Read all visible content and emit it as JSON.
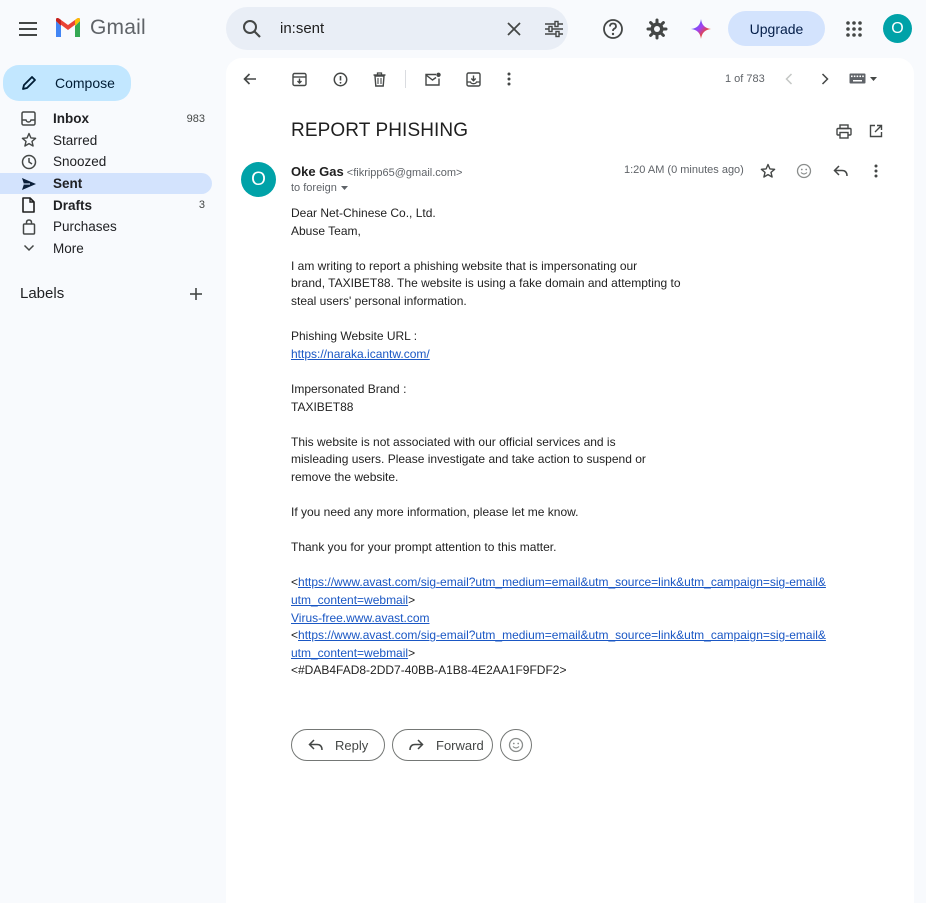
{
  "app": {
    "name": "Gmail"
  },
  "search": {
    "value": "in:sent"
  },
  "topbar": {
    "upgrade_label": "Upgrade",
    "avatar_letter": "O"
  },
  "sidebar": {
    "compose_label": "Compose",
    "items": [
      {
        "label": "Inbox",
        "count": "983"
      },
      {
        "label": "Starred",
        "count": ""
      },
      {
        "label": "Snoozed",
        "count": ""
      },
      {
        "label": "Sent",
        "count": ""
      },
      {
        "label": "Drafts",
        "count": "3"
      },
      {
        "label": "Purchases",
        "count": ""
      },
      {
        "label": "More",
        "count": ""
      }
    ],
    "labels_title": "Labels"
  },
  "toolbar": {
    "pager": "1 of 783"
  },
  "email": {
    "subject": "REPORT PHISHING",
    "sender_letter": "O",
    "sender_name": "Oke Gas",
    "sender_email": "<fikripp65@gmail.com>",
    "to": "to foreign",
    "timestamp": "1:20 AM (0 minutes ago)",
    "body": {
      "l1": "Dear Net-Chinese Co., Ltd.",
      "l2": "Abuse Team,",
      "l3": "I am writing to report a phishing website that is impersonating our",
      "l4": "brand, TAXIBET88. The website is using a fake domain and attempting to",
      "l5": "steal users' personal information.",
      "l6": "Phishing Website URL :",
      "l7": "https://naraka.icantw.com/",
      "l8": "Impersonated Brand :",
      "l9": "TAXIBET88",
      "l10": "This website is not associated with our official services and is",
      "l11": "misleading users. Please investigate and take action to suspend or",
      "l12": "remove the website.",
      "l13": "If you need any more information, please let me know.",
      "l14": "Thank you for your prompt attention to this matter.",
      "lt": "<",
      "gt": ">",
      "avast_link_a": "https://www.avast.com/sig-email?utm_medium=email&utm_source=link&utm_campaign=sig-email&",
      "avast_link_b": "utm_content=webmail",
      "virus_free": "Virus-free.www.avast.com",
      "dab": "<#DAB4FAD8-2DD7-40BB-A1B8-4E2AA1F9FDF2>"
    }
  },
  "actions": {
    "reply": "Reply",
    "forward": "Forward"
  },
  "colors": {
    "accent": "#0b57d0",
    "avatar": "#00a2a8",
    "compose": "#c2e7ff",
    "active_nav": "#d3e3fd"
  }
}
